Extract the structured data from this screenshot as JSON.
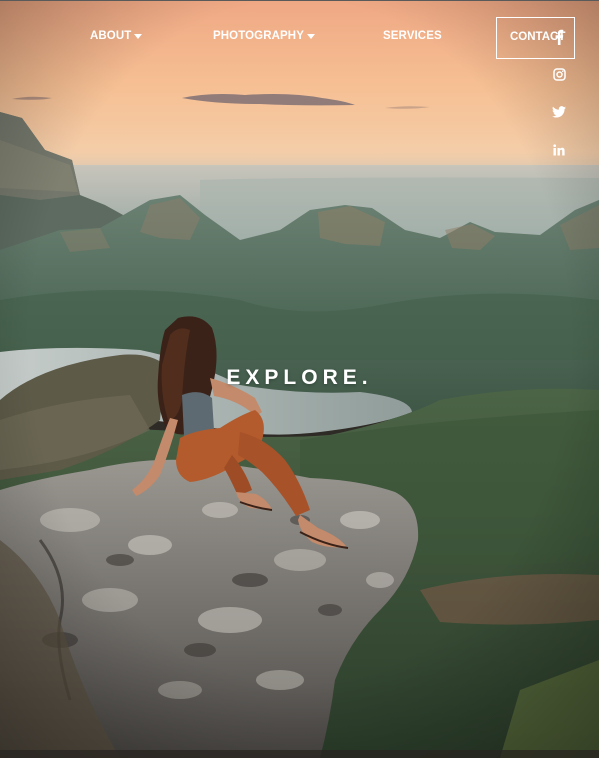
{
  "nav": {
    "about_label": "ABOUT",
    "photography_label": "PHOTOGRAPHY",
    "services_label": "SERVICES",
    "contact_label": "CONTACT"
  },
  "social": {
    "icons": [
      "facebook-icon",
      "instagram-icon",
      "twitter-icon",
      "linkedin-icon"
    ]
  },
  "hero": {
    "headline": "EXPLORE."
  },
  "colors": {
    "nav_text": "#ffffff",
    "sky_top": "#f2b489",
    "sky_horizon": "#f9c79a",
    "mountain": "#4f6a57",
    "rock": "#8b8782",
    "pants": "#b35b2c"
  }
}
